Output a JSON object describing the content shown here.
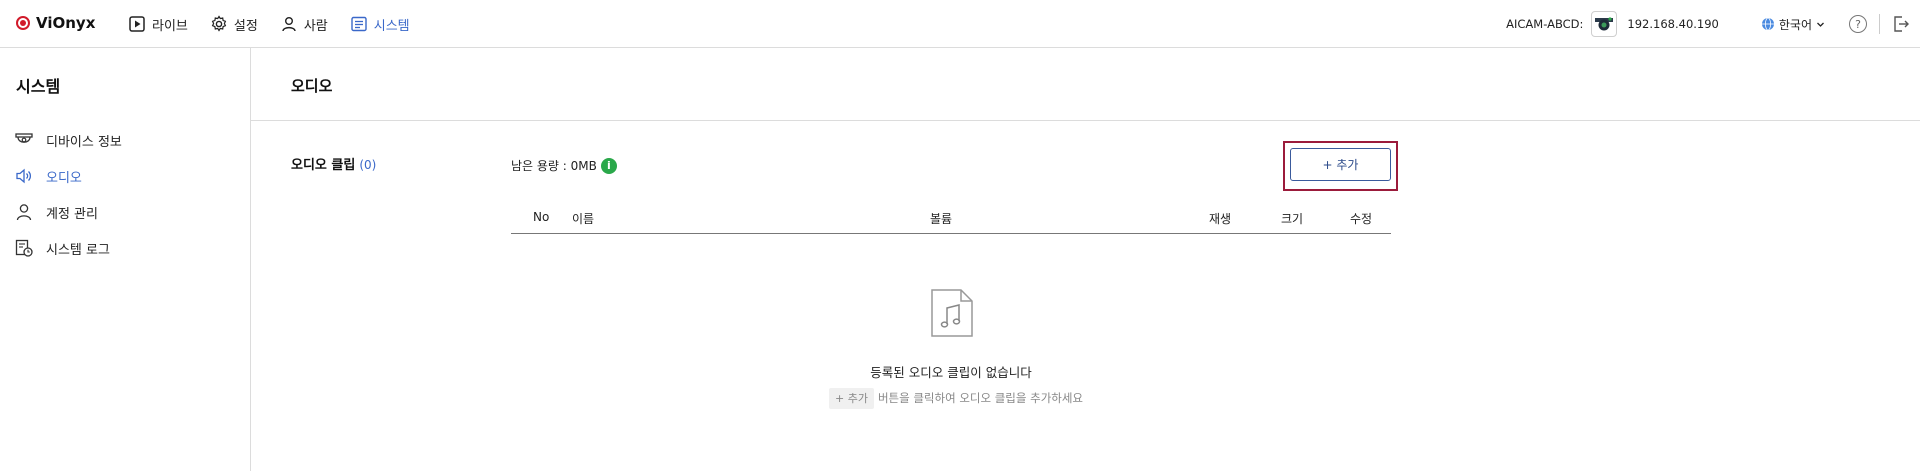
{
  "app": {
    "name": "ViOnyx"
  },
  "nav": [
    {
      "label": "라이브",
      "icon": "play-icon"
    },
    {
      "label": "설정",
      "icon": "gear-icon"
    },
    {
      "label": "사람",
      "icon": "person-icon"
    },
    {
      "label": "시스템",
      "icon": "system-icon",
      "active": true
    }
  ],
  "header_right": {
    "device_name": "AICAM-ABCD:",
    "device_ip": "192.168.40.190",
    "language": "한국어"
  },
  "sidebar": {
    "title": "시스템",
    "items": [
      {
        "label": "디바이스 정보",
        "icon": "camera-icon"
      },
      {
        "label": "오디오",
        "icon": "speaker-icon",
        "active": true
      },
      {
        "label": "계정 관리",
        "icon": "person-icon"
      },
      {
        "label": "시스템 로그",
        "icon": "log-icon"
      }
    ]
  },
  "main": {
    "title": "오디오",
    "section": {
      "label": "오디오 클립",
      "count": "(0)"
    },
    "capacity": "남은 용량 : 0MB",
    "add_button": "+ 추가",
    "columns": [
      "No",
      "이름",
      "볼륨",
      "재생",
      "크기",
      "수정"
    ],
    "empty": {
      "title": "등록된 오디오 클립이 없습니다",
      "hint_chip": "+ 추가",
      "hint_text": "버튼을 클릭하여 오디오 클립을 추가하세요"
    }
  },
  "colors": {
    "accent": "#3a68c9",
    "highlight": "#9b1b3b",
    "info": "#2aa84a"
  }
}
